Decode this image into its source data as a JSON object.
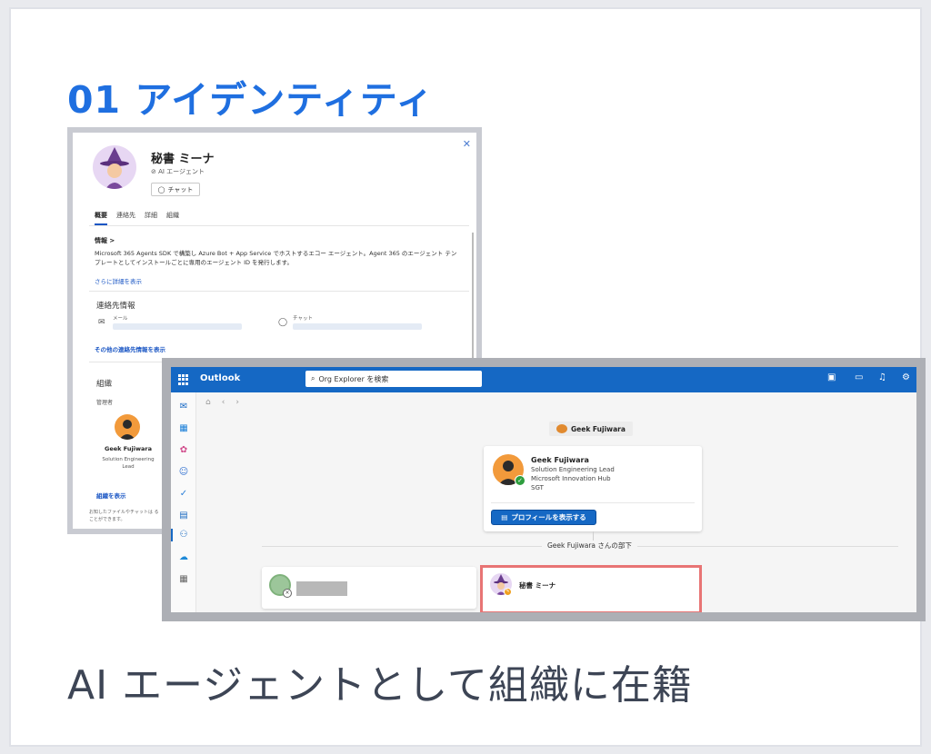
{
  "slide": {
    "title": "01  アイデンティティ",
    "subtitle": "AI エージェントとして組織に在籍"
  },
  "profile_card": {
    "name": "秘書 ミーナ",
    "agent_tag": "AI エージェント",
    "chat_button": "チャット",
    "tabs": [
      "概要",
      "連絡先",
      "詳細",
      "組織"
    ],
    "info_heading": "情報 >",
    "info_text": "Microsoft 365 Agents SDK で構築し Azure Bot + App Service でホストするエコー エージェント。Agent 365 のエージェント テンプレートとしてインストールごとに専用のエージェント ID を発行します。",
    "show_more": "さらに詳細を表示",
    "contact_heading": "連絡先情報",
    "mail_label": "メール",
    "chat_label": "チャット",
    "more_contact": "その他の連絡先情報を表示",
    "org_heading": "組織",
    "manager_label": "管理者",
    "manager_name": "Geek Fujiwara",
    "manager_title": "Solution Engineering Lead",
    "org_link": "組織を表示",
    "footer_note": "お知したファイルやチャットは ることができます。"
  },
  "outlook": {
    "app_name": "Outlook",
    "search_placeholder": "Org Explorer を検索",
    "top_pill": "Geek Fujiwara",
    "person": {
      "name": "Geek Fujiwara",
      "title": "Solution Engineering Lead",
      "dept": "Microsoft Innovation Hub",
      "org": "SGT",
      "profile_button": "プロフィールを表示する"
    },
    "reports_label": "Geek Fujiwara さんの部下",
    "report_agent_name": "秘書 ミーナ"
  },
  "colors": {
    "title_blue": "#1f6fe0",
    "outlook_blue": "#1568c4",
    "highlight_red": "#e87474"
  }
}
